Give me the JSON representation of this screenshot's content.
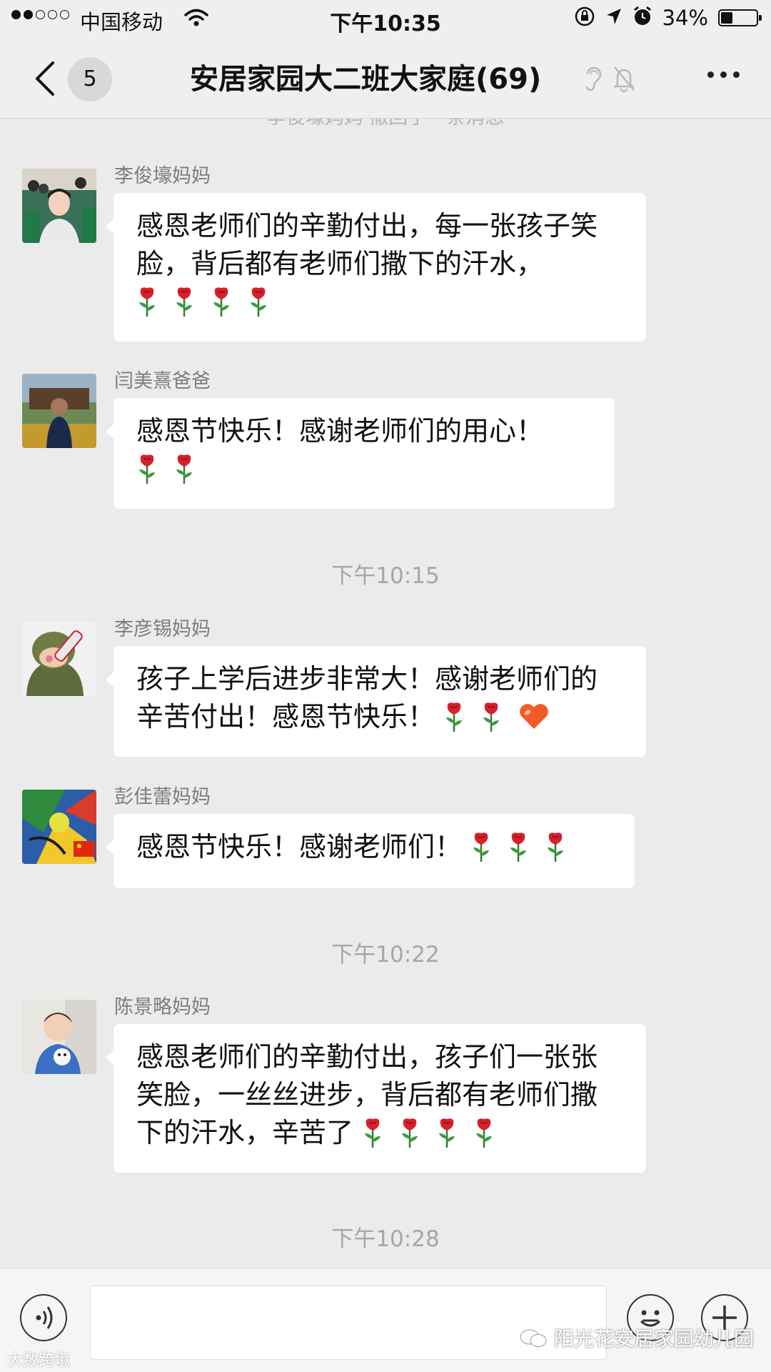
{
  "status_bar": {
    "carrier": "中国移动",
    "time": "下午10:35",
    "battery_percent": "34%",
    "battery_level": 0.34
  },
  "header": {
    "unread_count": "5",
    "title": "安居家园大二班大家庭(69)"
  },
  "chat": {
    "recalled_notice": "李俊壕妈妈 撤回了一条消息",
    "messages": [
      {
        "sender": "李俊壕妈妈",
        "text": "感恩老师们的辛勤付出，每一张孩子笑脸，背后都有老师们撒下的汗水，",
        "emoji": [
          "rose",
          "rose",
          "rose",
          "rose"
        ]
      },
      {
        "sender": "闫美熹爸爸",
        "text": "感恩节快乐！感谢老师们的用心！",
        "emoji": [
          "rose",
          "rose"
        ]
      },
      {
        "sender": "李彦锡妈妈",
        "text": "孩子上学后进步非常大！感谢老师们的辛苦付出！感恩节快乐！",
        "emoji": [
          "rose",
          "rose",
          "heart"
        ]
      },
      {
        "sender": "彭佳蕾妈妈",
        "text": "感恩节快乐！感谢老师们！",
        "emoji": [
          "rose",
          "rose",
          "rose"
        ]
      },
      {
        "sender": "陈景略妈妈",
        "text": "感恩老师们的辛勤付出，孩子们一张张笑脸，一丝丝进步，背后都有老师们撒下的汗水，辛苦了",
        "emoji": [
          "rose",
          "rose",
          "rose",
          "rose"
        ]
      }
    ],
    "timestamps": [
      "下午10:15",
      "下午10:22",
      "下午10:28"
    ]
  },
  "input_bar": {
    "value": ""
  },
  "watermarks": {
    "account": "阳光花安居家园幼儿园",
    "source": "大数跨境"
  },
  "colors": {
    "background": "#ebebeb",
    "bubble": "#ffffff",
    "rose": "#d6202c",
    "heart": "#f25a2a"
  }
}
